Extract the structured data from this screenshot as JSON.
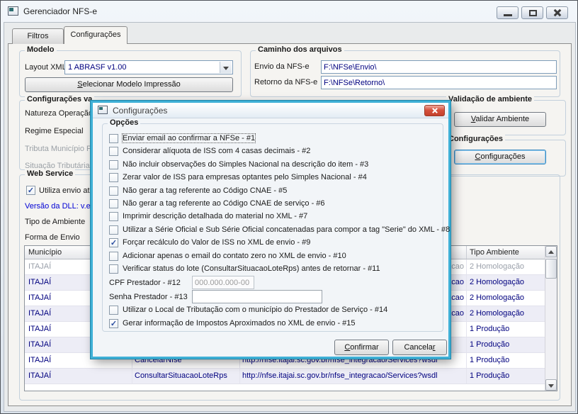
{
  "window": {
    "title": "Gerenciador NFS-e"
  },
  "tabs": {
    "filtros": "Filtros",
    "configuracoes": "Configurações"
  },
  "modelo": {
    "title": "Modelo",
    "layout_label": "Layout XML",
    "layout_value": "1 ABRASF v1.00",
    "select_button": "Selecionar Modelo Impressão"
  },
  "caminho": {
    "title": "Caminho dos arquivos",
    "envio_label": "Envio da NFS-e",
    "envio_value": "F:\\NFSe\\Envio\\",
    "retorno_label": "Retorno da NFS-e",
    "retorno_value": "F:\\NFSe\\Retorno\\"
  },
  "config_variaveis": {
    "title": "Configurações va",
    "natureza": "Natureza Operação",
    "regime": "Regime Especial",
    "tributa": "Tributa Município Pr",
    "situacao": "Situação Tributária"
  },
  "web_service": {
    "title": "Web Service",
    "utiliza_label": "Utiliza envio atra",
    "utiliza_glyph": "✓",
    "dll_label": "Versão da DLL: v.e",
    "tipo_label": "Tipo de Ambiente",
    "forma_label": "Forma de Envio"
  },
  "validacao": {
    "title": "Validação de ambiente",
    "button": "Validar Ambiente"
  },
  "configuracoes": {
    "title": "Configurações",
    "button": "Configurações"
  },
  "table": {
    "headers": [
      "Município",
      "",
      "",
      "Tipo Ambiente"
    ],
    "rows": [
      {
        "municipio": "ITAJAÍ",
        "servico": "",
        "url": "acao",
        "tipo": "2 Homologação"
      },
      {
        "municipio": "ITAJAÍ",
        "servico": "",
        "url": "acao",
        "tipo": "2 Homologação"
      },
      {
        "municipio": "ITAJAÍ",
        "servico": "",
        "url": "acao",
        "tipo": "2 Homologação"
      },
      {
        "municipio": "ITAJAÍ",
        "servico": "",
        "url": "acao",
        "tipo": "2 Homologação"
      },
      {
        "municipio": "ITAJAÍ",
        "servico": "",
        "url": "",
        "tipo": "1 Produção"
      },
      {
        "municipio": "ITAJAÍ",
        "servico": "",
        "url": "",
        "tipo": "1 Produção"
      },
      {
        "municipio": "ITAJAÍ",
        "servico": "CancelarNfse",
        "url": "http://nfse.itajai.sc.gov.br/nfse_integracao/Services?wsdl",
        "tipo": "1 Produção"
      },
      {
        "municipio": "ITAJAÍ",
        "servico": "ConsultarSituacaoLoteRps",
        "url": "http://nfse.itajai.sc.gov.br/nfse_integracao/Services?wsdl",
        "tipo": "1 Produção"
      }
    ]
  },
  "dialog": {
    "title": "Configurações",
    "opcoes_title": "Opções",
    "options": [
      {
        "label": "Enviar email ao confirmar a NFSe - #1"
      },
      {
        "label": "Considerar alíquota de ISS com 4 casas decimais - #2"
      },
      {
        "label": "Não incluir observações do Simples Nacional na descrição do item - #3"
      },
      {
        "label": "Zerar valor de ISS para empresas optantes pelo Simples Nacional - #4"
      },
      {
        "label": "Não gerar a tag referente ao Código CNAE - #5"
      },
      {
        "label": "Não gerar a tag referente ao Código CNAE de serviço - #6"
      },
      {
        "label": "Imprimir descrição detalhada do material no XML - #7"
      },
      {
        "label": "Utilizar a Série Oficial e Sub Série Oficial concatenadas para compor a tag \"Serie\" do XML - #8"
      },
      {
        "label": "Forçar recálculo do Valor de ISS no XML de envio - #9",
        "glyph": "✓"
      },
      {
        "label": "Adicionar apenas o email do contato zero no XML de envio - #10"
      },
      {
        "label": "Verificar status do lote (ConsultarSituacaoLoteRps) antes de retornar - #11"
      },
      {
        "label": "Utilizar o Local de Tributação com o município do Prestador de Serviço - #14"
      },
      {
        "label": "Gerar informação de Impostos Aproximados no XML de envio - #15",
        "glyph": "✓"
      }
    ],
    "cpf_label": "CPF Prestador - #12",
    "cpf_value": "000.000.000-00",
    "senha_label": "Senha Prestador - #13",
    "senha_value": "",
    "confirm": "Confirmar",
    "cancel": "Cancelar"
  },
  "colors": {
    "dialog_border": "#3fb0d6",
    "close_button": "#d6523c",
    "value_text": "#00007f",
    "link_text": "#0000d4",
    "row_alt": "#ededf6"
  }
}
